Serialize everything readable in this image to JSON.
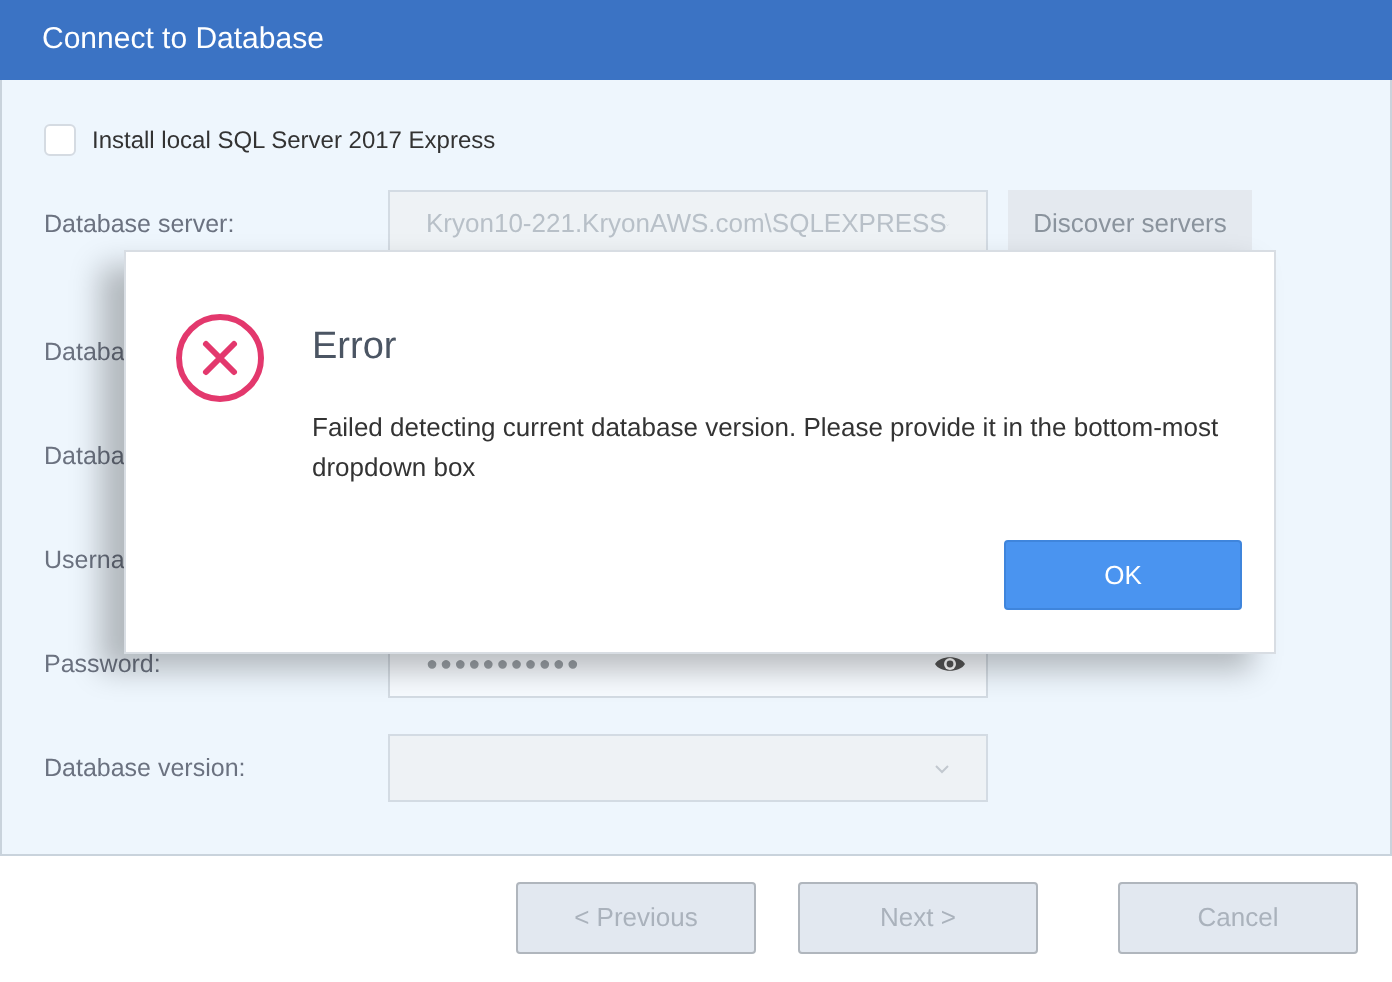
{
  "window": {
    "title": "Connect to Database"
  },
  "install_checkbox": {
    "label": "Install local SQL Server 2017 Express",
    "checked": false
  },
  "fields": [
    {
      "label": "Database server:",
      "kind": "dropdown",
      "value": "Kryon10-221.KryonAWS.com\\SQLEXPRESS",
      "disabled": true
    },
    {
      "label": "Databa",
      "kind": "covered"
    },
    {
      "label": "Databa",
      "kind": "covered"
    },
    {
      "label": "Userna",
      "kind": "covered"
    },
    {
      "label": "Password:",
      "kind": "password",
      "value": "●●●●●●●●●●●"
    },
    {
      "label": "Database version:",
      "kind": "dropdown",
      "disabled": true
    }
  ],
  "discover_button": {
    "label": "Discover servers",
    "disabled": true
  },
  "footer_buttons": [
    {
      "label": "< Previous",
      "disabled": true
    },
    {
      "label": "Next >",
      "disabled": true
    },
    {
      "label": "Cancel",
      "disabled": true
    }
  ],
  "dialog": {
    "title": "Error",
    "message": "Failed detecting current database version. Please provide it in the bottom-most dropdown box",
    "buttons": [
      "OK"
    ]
  }
}
